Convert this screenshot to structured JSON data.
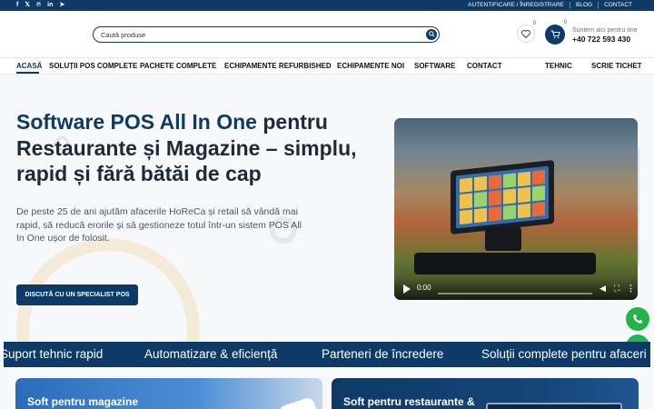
{
  "topbar": {
    "social": [
      {
        "icon": "facebook-icon",
        "glyph": "f"
      },
      {
        "icon": "x-icon",
        "glyph": "𝕏"
      },
      {
        "icon": "pinterest-icon",
        "glyph": "℗"
      },
      {
        "icon": "linkedin-icon",
        "glyph": "in"
      },
      {
        "icon": "telegram-icon",
        "glyph": "➤"
      }
    ],
    "links": [
      "AUTENTIFICARE / ÎNREGISTRARE",
      "BLOG",
      "CONTACT"
    ]
  },
  "header": {
    "search_placeholder": "Caută produse",
    "wishlist_count": "0",
    "cart_count": "0",
    "phone_label": "Suntem aici pentru tine",
    "phone_number": "+40 722 593 430"
  },
  "nav": {
    "items": [
      "ACASĂ",
      "SOLUȚII POS COMPLETE",
      "PACHETE COMPLETE",
      "ECHIPAMENTE REFURBISHED",
      "ECHIPAMENTE NOI",
      "SOFTWARE",
      "CONTACT",
      "TEHNIC",
      "SCRIE TICHET"
    ]
  },
  "hero": {
    "title_highlight": "Software POS All In One",
    "title_rest": " pentru Restaurante și Magazine – simplu, rapid și fără bătăi de cap",
    "description": "De peste 25 de ani ajutăm afacerile HoReCa și retail să vândă mai rapid, să reducă erorile și să gestioneze totul într-un sistem POS All In One ușor de folosit.",
    "cta_label": "DISCUTĂ CU UN SPECIALIST POS",
    "video_time": "0:00"
  },
  "ticker": {
    "items": [
      "Suport tehnic rapid",
      "Automatizare & eficiență",
      "Parteneri de încredere",
      "Soluții complete pentru afaceri"
    ]
  },
  "cards": {
    "left_title": "Soft pentru magazine",
    "right_title": "Soft pentru restaurante &"
  },
  "colors": {
    "brand": "#0d3a66",
    "whatsapp": "#1fb855",
    "phone_float": "#22b34a"
  }
}
